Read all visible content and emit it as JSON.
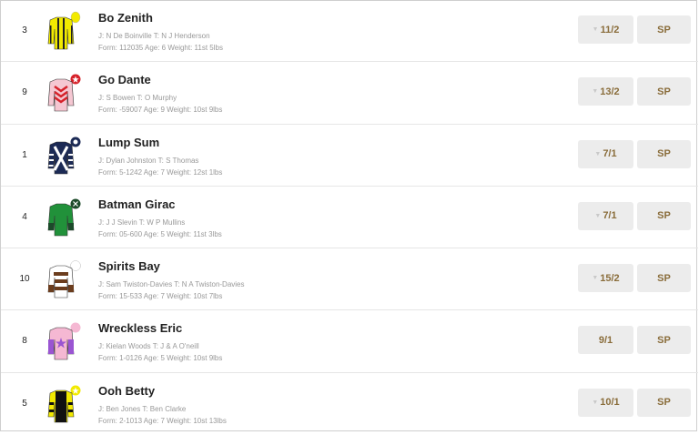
{
  "runners": [
    {
      "number": "3",
      "name": "Bo Zenith",
      "jt": "J: N De Boinville T: N J Henderson",
      "info": "Form: 112035 Age: 6 Weight: 11st 5lbs",
      "odds": "11/2",
      "sp": "SP",
      "silk": "bo-zenith-silk-icon"
    },
    {
      "number": "9",
      "name": "Go Dante",
      "jt": "J: S Bowen T: O Murphy",
      "info": "Form: -59007 Age: 9 Weight: 10st 9lbs",
      "odds": "13/2",
      "sp": "SP",
      "silk": "go-dante-silk-icon"
    },
    {
      "number": "1",
      "name": "Lump Sum",
      "jt": "J: Dylan Johnston T: S Thomas",
      "info": "Form: 5-1242 Age: 7 Weight: 12st 1lbs",
      "odds": "7/1",
      "sp": "SP",
      "silk": "lump-sum-silk-icon"
    },
    {
      "number": "4",
      "name": "Batman Girac",
      "jt": "J: J J Slevin T: W P Mullins",
      "info": "Form: 05-600 Age: 5 Weight: 11st 3lbs",
      "odds": "7/1",
      "sp": "SP",
      "silk": "batman-girac-silk-icon"
    },
    {
      "number": "10",
      "name": "Spirits Bay",
      "jt": "J: Sam Twiston-Davies T: N A Twiston-Davies",
      "info": "Form: 15-533 Age: 7 Weight: 10st 7lbs",
      "odds": "15/2",
      "sp": "SP",
      "silk": "spirits-bay-silk-icon"
    },
    {
      "number": "8",
      "name": "Wreckless Eric",
      "jt": "J: Kielan Woods T: J & A O'neill",
      "info": "Form: 1-0126 Age: 5 Weight: 10st 9lbs",
      "odds": "9/1",
      "sp": "SP",
      "silk": "wreckless-eric-silk-icon"
    },
    {
      "number": "5",
      "name": "Ooh Betty",
      "jt": "J: Ben Jones T: Ben Clarke",
      "info": "Form: 2-1013 Age: 7 Weight: 10st 13lbs",
      "odds": "10/1",
      "sp": "SP",
      "silk": "ooh-betty-silk-icon"
    }
  ]
}
